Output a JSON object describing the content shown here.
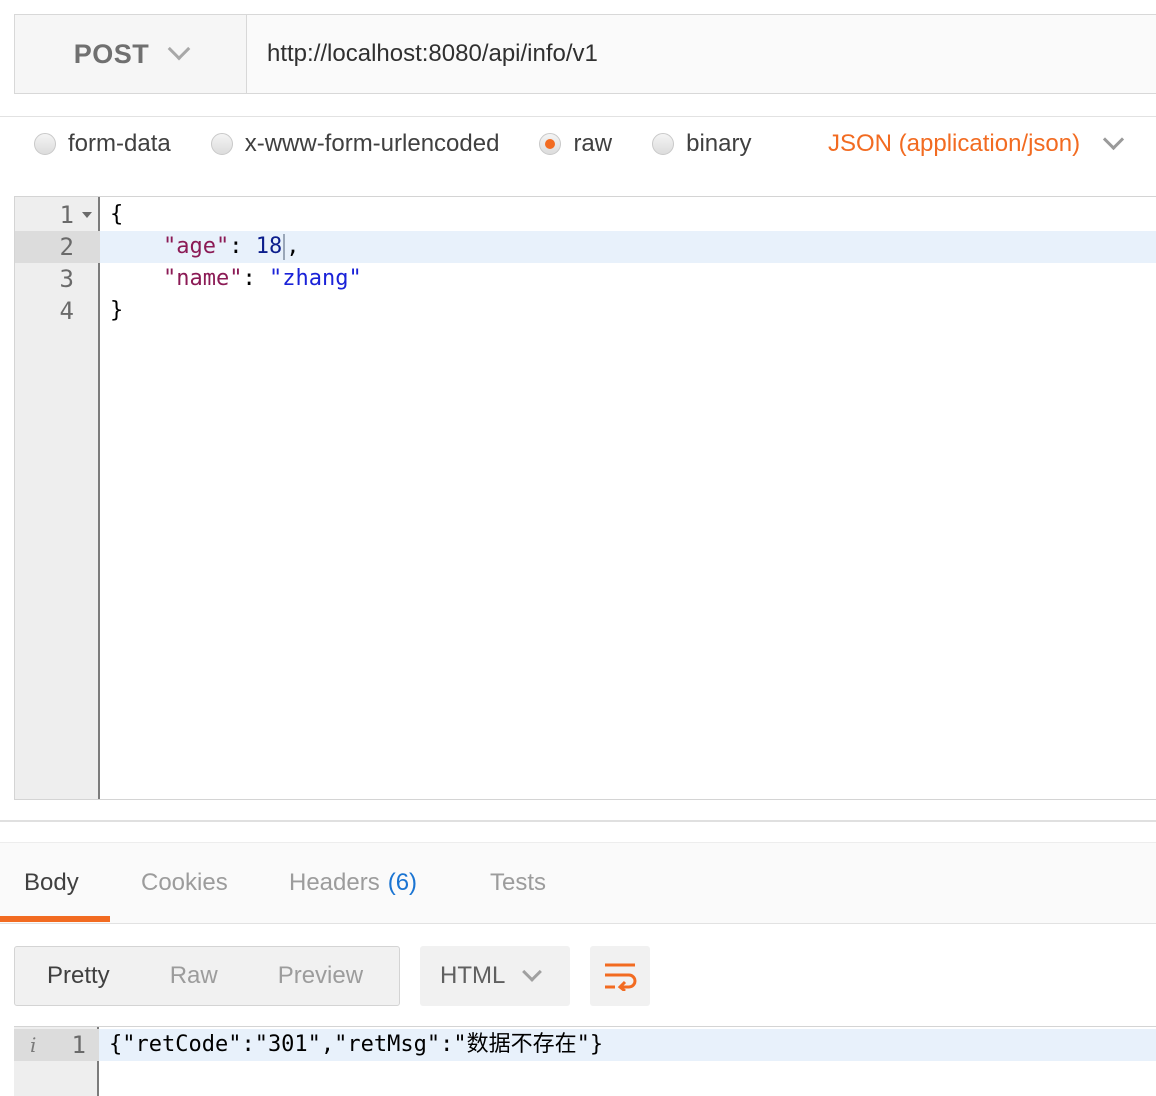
{
  "request": {
    "method": "POST",
    "url": "http://localhost:8080/api/info/v1"
  },
  "body_types": {
    "options": [
      "form-data",
      "x-www-form-urlencoded",
      "raw",
      "binary"
    ],
    "selected": "raw",
    "content_type": "JSON (application/json)"
  },
  "editor": {
    "line_numbers": [
      "1",
      "2",
      "3",
      "4"
    ],
    "lines": [
      "{",
      "    \"age\": 18,",
      "    \"name\": \"zhang\"",
      "}"
    ],
    "active_line": 2
  },
  "response": {
    "tabs": [
      "Body",
      "Cookies",
      "Headers",
      "Tests"
    ],
    "active_tab": "Body",
    "headers_count": "(6)",
    "view_modes": [
      "Pretty",
      "Raw",
      "Preview"
    ],
    "active_view": "Pretty",
    "format": "HTML",
    "line_number": "1",
    "body": "{\"retCode\":\"301\",\"retMsg\":\"数据不存在\"}"
  },
  "colors": {
    "accent": "#f26b21",
    "headers_count": "#1a74d2",
    "json_key": "#8b1a55",
    "json_number": "#0c1e8c",
    "json_string": "#1a22d8",
    "active_line": "#e8f1fb"
  },
  "icons": [
    "chevron-down-icon",
    "fold-arrow-icon",
    "info-icon",
    "wrap-lines-icon"
  ]
}
